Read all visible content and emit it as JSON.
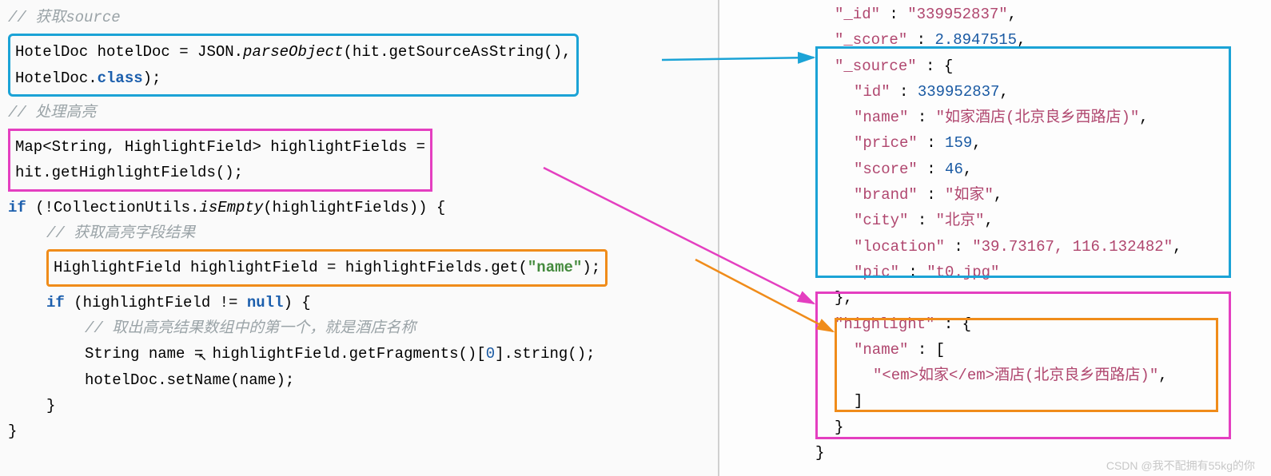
{
  "left": {
    "c1": "// 获取source",
    "box1_l1": "HotelDoc hotelDoc = JSON.",
    "box1_l1b": "parseObject",
    "box1_l1c": "(hit.getSourceAsString(),",
    "box1_l2": "HotelDoc.",
    "box1_l2b": "class",
    "box1_l2c": ");",
    "c2": "// 处理高亮",
    "box2_l1": "Map<String, HighlightField> highlightFields =",
    "box2_l2": "hit.getHighlightFields();",
    "if1_a": "if",
    "if1_b": " (!CollectionUtils.",
    "if1_c": "isEmpty",
    "if1_d": "(highlightFields)) {",
    "c3": "// 获取高亮字段结果",
    "box3_a": "HighlightField highlightField = highlightFields.get(",
    "box3_b": "\"name\"",
    "box3_c": ");",
    "if2_a": "if",
    "if2_b": " (highlightField != ",
    "if2_c": "null",
    "if2_d": ") {",
    "c4": "// 取出高亮结果数组中的第一个，就是酒店名称",
    "frag_a": "String name = highlightField.getFragments()[",
    "frag_b": "0",
    "frag_c": "].string();",
    "setn": "hotelDoc.setName(name);",
    "close1": "}",
    "close2": "}"
  },
  "right": {
    "l1a": "\"_id\"",
    "l1b": " : ",
    "l1c": "\"339952837\"",
    "l1d": ",",
    "l2a": "\"_score\"",
    "l2b": " : ",
    "l2c": "2.8947515",
    "l2d": ",",
    "l3a": "\"_source\"",
    "l3b": " : {",
    "l4a": "\"id\"",
    "l4b": " : ",
    "l4c": "339952837",
    "l4d": ",",
    "l5a": "\"name\"",
    "l5b": " : ",
    "l5c": "\"如家酒店(北京良乡西路店)\"",
    "l5d": ",",
    "l6a": "\"price\"",
    "l6b": " : ",
    "l6c": "159",
    "l6d": ",",
    "l7a": "\"score\"",
    "l7b": " : ",
    "l7c": "46",
    "l7d": ",",
    "l8a": "\"brand\"",
    "l8b": " : ",
    "l8c": "\"如家\"",
    "l8d": ",",
    "l9a": "\"city\"",
    "l9b": " : ",
    "l9c": "\"北京\"",
    "l9d": ",",
    "l10a": "\"location\"",
    "l10b": " : ",
    "l10c": "\"39.73167, 116.132482\"",
    "l10d": ",",
    "l11a": "\"pic\"",
    "l11b": " : ",
    "l11c": "\"t0.jpg\"",
    "l12": "},",
    "l13a": "\"highlight\"",
    "l13b": " : {",
    "l14a": "\"name\"",
    "l14b": " : [",
    "l15": "\"<em>如家</em>酒店(北京良乡西路店)\"",
    "l15b": ",",
    "l16": "]",
    "l17": "}",
    "l18": "}"
  },
  "watermark": "CSDN @我不配拥有55kg的你"
}
